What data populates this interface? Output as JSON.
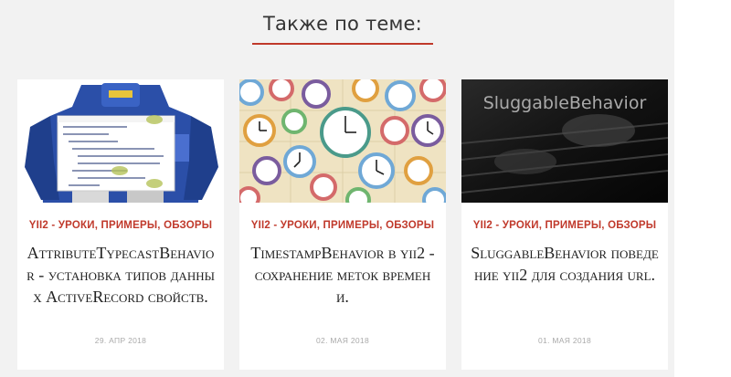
{
  "section": {
    "title": "Также по теме:"
  },
  "cards": [
    {
      "category": "YII2 - УРОКИ, ПРИМЕРЫ, ОБЗОРЫ",
      "title": "AttributeTypecastBehavior - установка типов данных ActiveRecord свойств.",
      "date": "29. АПР 2018",
      "image_desc": "robot-with-code-image"
    },
    {
      "category": "YII2 - УРОКИ, ПРИМЕРЫ, ОБЗОРЫ",
      "title": "TimestampBehavior в yii2 - сохранение меток времени.",
      "date": "02. МАЯ 2018",
      "image_desc": "clocks-image"
    },
    {
      "category": "YII2 - УРОКИ, ПРИМЕРЫ, ОБЗОРЫ",
      "title": "SluggableBehavior поведение yii2 для создания url.",
      "date": "01. МАЯ 2018",
      "image_desc": "keyboard-typing-image",
      "image_caption": "SluggableBehavior"
    }
  ],
  "colors": {
    "accent": "#c0392b",
    "panel": "#f2f2f2"
  }
}
